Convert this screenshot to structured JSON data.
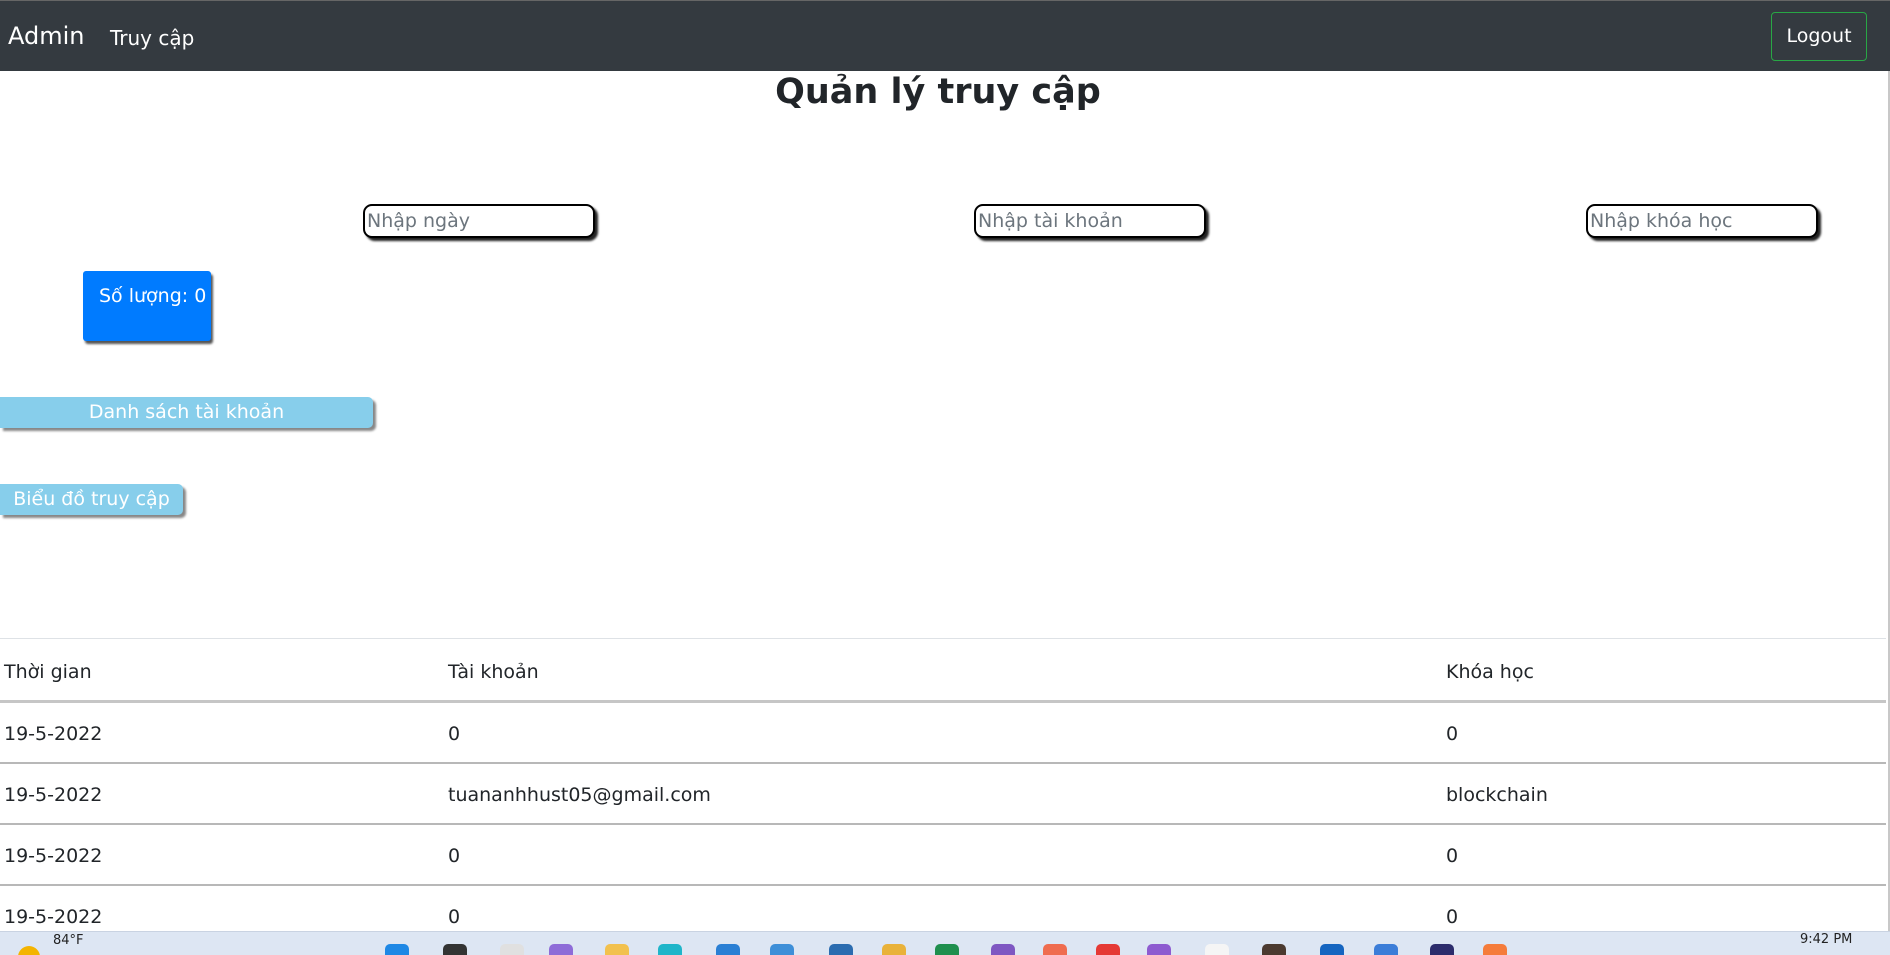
{
  "navbar": {
    "brand": "Admin",
    "nav_link": "Truy cập",
    "logout": "Logout"
  },
  "page": {
    "title": "Quản lý truy cập"
  },
  "filters": {
    "date_placeholder": "Nhập ngày",
    "account_placeholder": "Nhập tài khoản",
    "course_placeholder": "Nhập khóa học"
  },
  "count": {
    "label": "Số lượng:",
    "value": "0"
  },
  "buttons": {
    "accounts": "Danh sách tài khoản",
    "chart": "Biểu đồ truy cập"
  },
  "table": {
    "headers": [
      "Thời gian",
      "Tài khoản",
      "Khóa học"
    ],
    "rows": [
      [
        "19-5-2022",
        "0",
        "0"
      ],
      [
        "19-5-2022",
        "tuananhhust05@gmail.com",
        "blockchain"
      ],
      [
        "19-5-2022",
        "0",
        "0"
      ],
      [
        "19-5-2022",
        "0",
        "0"
      ]
    ]
  },
  "taskbar": {
    "weather": "84°F",
    "time": "9:42 PM",
    "icons": [
      "weather-icon",
      "windows-start-icon",
      "search-icon",
      "task-view-icon",
      "chat-icon",
      "file-explorer-icon",
      "edge-browser-icon",
      "vscode-icon",
      "mail-icon",
      "photoshop-icon",
      "folder-icon",
      "excel-icon",
      "visual-studio-icon",
      "postman-icon",
      "chrome-icon",
      "visual-studio-preview-icon",
      "generic-app-icon",
      "photo-app-icon",
      "app-icon-blue",
      "settings-app-icon",
      "app-icon-purple",
      "app-icon-orange"
    ],
    "icon_colors": [
      "#1e88e5",
      "#333333",
      "#e0e0e0",
      "#8e6cd8",
      "#f2c14e",
      "#1fb5c9",
      "#2a7fd4",
      "#3e8fd8",
      "#2b6cb0",
      "#e9b23a",
      "#1f8f4e",
      "#7e57c2",
      "#ef6c4f",
      "#e53935",
      "#8e5bd0",
      "#f5f5f5",
      "#4b3a30",
      "#1565c0",
      "#3b7dd8",
      "#2c2c6c",
      "#f57c3b"
    ]
  }
}
